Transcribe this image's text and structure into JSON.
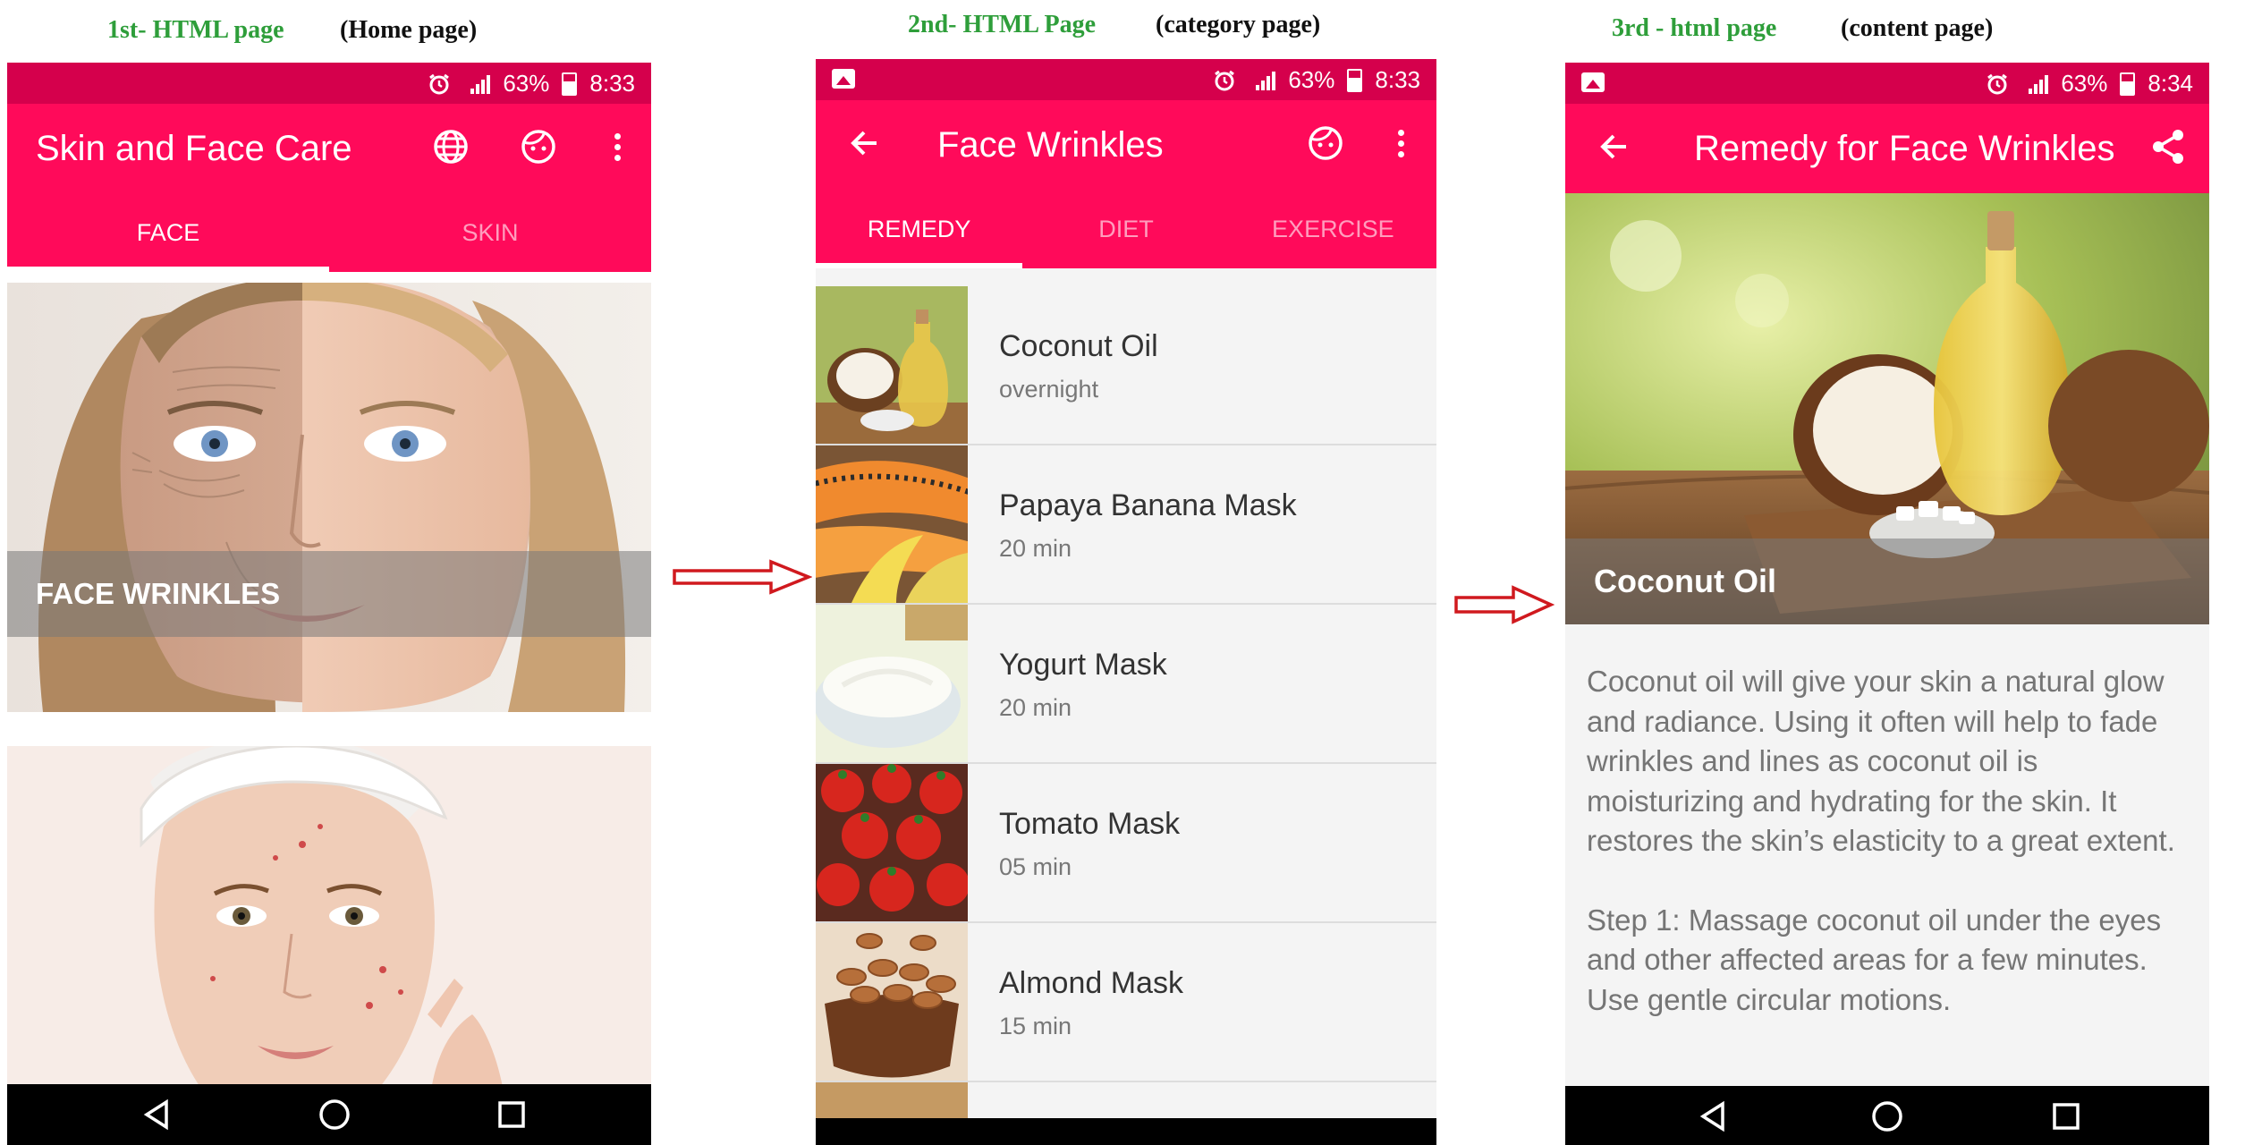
{
  "captions": {
    "page1": "1st- HTML page",
    "page1_note": "(Home page)",
    "page2": "2nd- HTML Page",
    "page2_note": "(category page)",
    "page3": "3rd - html page",
    "page3_note": "(content page)"
  },
  "colors": {
    "primary": "#ff0a5a",
    "status": "#d5004c",
    "accent_caption": "#2e9e3a"
  },
  "page1": {
    "status": {
      "battery": "63%",
      "time": "8:33"
    },
    "app_title": "Skin and Face Care",
    "icons": [
      "globe-icon",
      "face-icon",
      "more-vert-icon"
    ],
    "tabs": [
      {
        "label": "FACE",
        "active": true
      },
      {
        "label": "SKIN",
        "active": false
      }
    ],
    "cards": [
      {
        "label": "FACE WRINKLES"
      },
      {
        "label": ""
      }
    ]
  },
  "page2": {
    "status": {
      "battery": "63%",
      "time": "8:33"
    },
    "app_title": "Face Wrinkles",
    "tabs": [
      {
        "label": "REMEDY",
        "active": true
      },
      {
        "label": "DIET",
        "active": false
      },
      {
        "label": "EXERCISE",
        "active": false
      }
    ],
    "items": [
      {
        "name": "Coconut Oil",
        "sub": "overnight"
      },
      {
        "name": "Papaya Banana Mask",
        "sub": "20 min"
      },
      {
        "name": "Yogurt Mask",
        "sub": "20 min"
      },
      {
        "name": "Tomato Mask",
        "sub": "05 min"
      },
      {
        "name": "Almond Mask",
        "sub": "15 min"
      }
    ]
  },
  "page3": {
    "status": {
      "battery": "63%",
      "time": "8:34"
    },
    "app_title": "Remedy for Face Wrinkles",
    "hero_label": "Coconut Oil",
    "paragraphs": [
      "Coconut oil will give your skin a natural glow and radiance. Using it often will help to fade wrinkles and lines as coconut oil is moisturizing and hydrating for the skin. It restores the skin’s elasticity to a great extent.",
      "Step 1: Massage coconut oil under the eyes and other affected areas for a few minutes. Use gentle circular motions."
    ]
  }
}
